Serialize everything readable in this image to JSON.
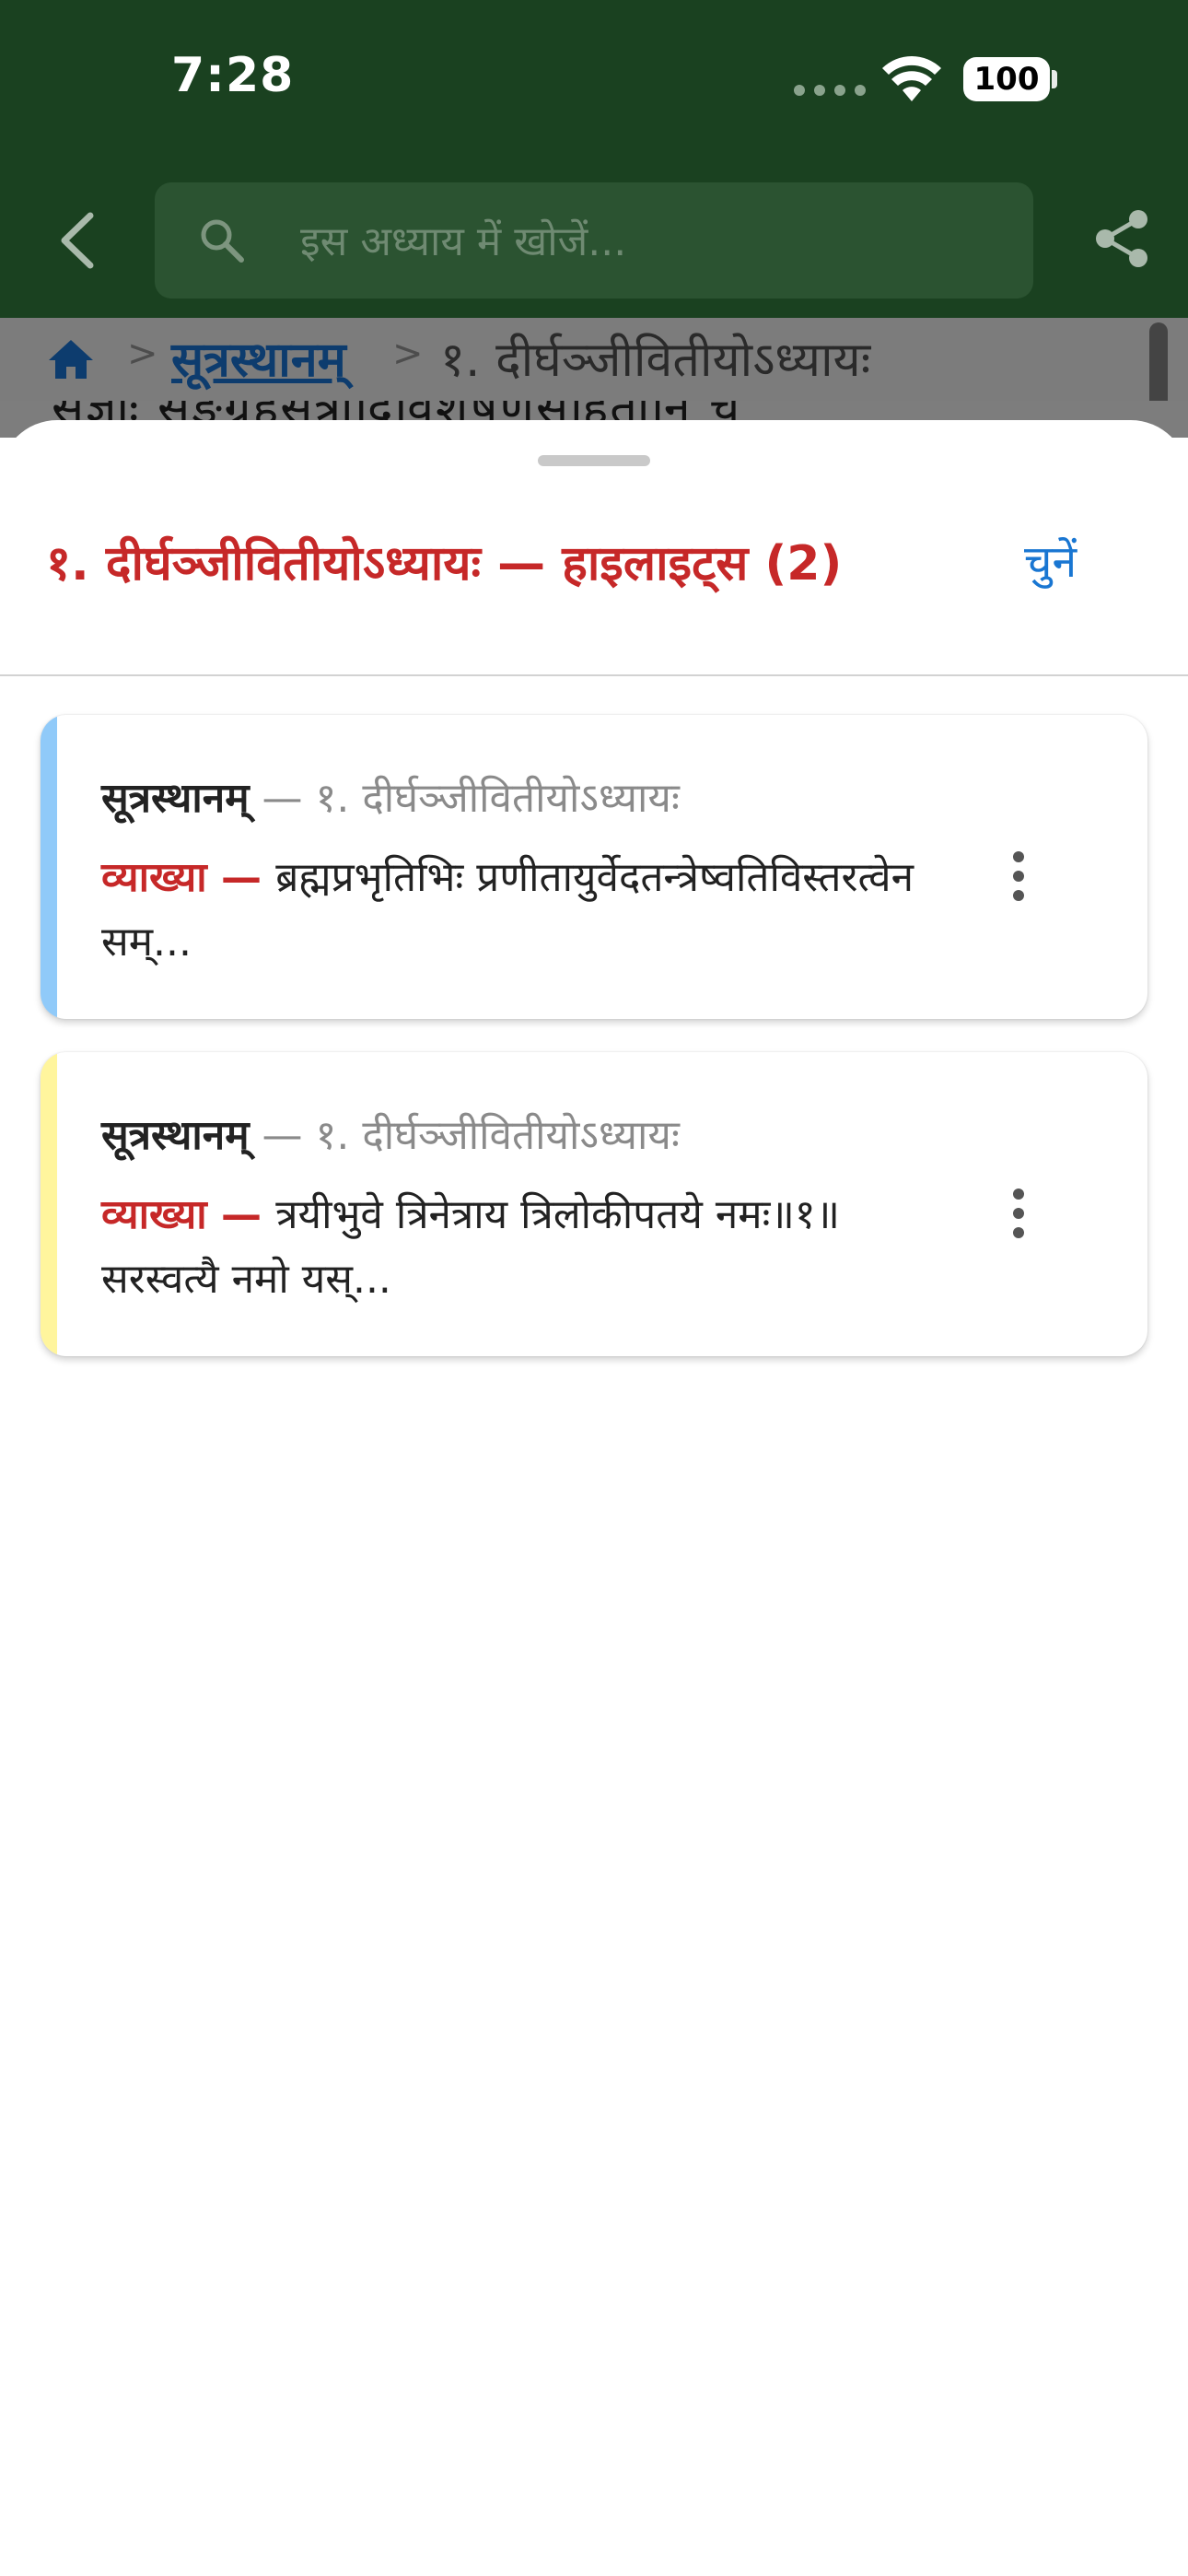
{
  "status_bar": {
    "time": "7:28",
    "battery": "100"
  },
  "toolbar": {
    "search_placeholder": "इस अध्याय में खोजें..."
  },
  "breadcrumb": {
    "book": "सूत्रस्थानम्",
    "chapter": "१. दीर्घञ्जीवितीयोऽध्यायः",
    "separator": ">"
  },
  "background_text": "संज्ञाः सङ्ग्रहसूत्रादिविशेषणसहितानि च",
  "sheet": {
    "title": "१. दीर्घञ्जीवितीयोऽध्यायः — हाइलाइट्स (2)",
    "select_label": "चुनें"
  },
  "highlights": [
    {
      "book": "सूत्रस्थानम्",
      "separator": " — ",
      "chapter": "१. दीर्घञ्जीवितीयोऽध्यायः",
      "label": "व्याख्या — ",
      "text": "ब्रह्मप्रभृतिभिः प्रणीतायुर्वेदतन्त्रेष्वतिविस्तरत्वेन सम्...",
      "color": "#90caf9"
    },
    {
      "book": "सूत्रस्थानम्",
      "separator": " — ",
      "chapter": "१. दीर्घञ्जीवितीयोऽध्यायः",
      "label": "व्याख्या — ",
      "text": "त्रयीभुवे त्रिनेत्राय त्रिलोकीपतये नमः॥१॥ सरस्वत्यै नमो यस्...",
      "color": "#fff59d"
    }
  ],
  "colors": {
    "appbar": "#1a4120",
    "accent_red": "#c62828",
    "accent_blue": "#1976d2"
  }
}
